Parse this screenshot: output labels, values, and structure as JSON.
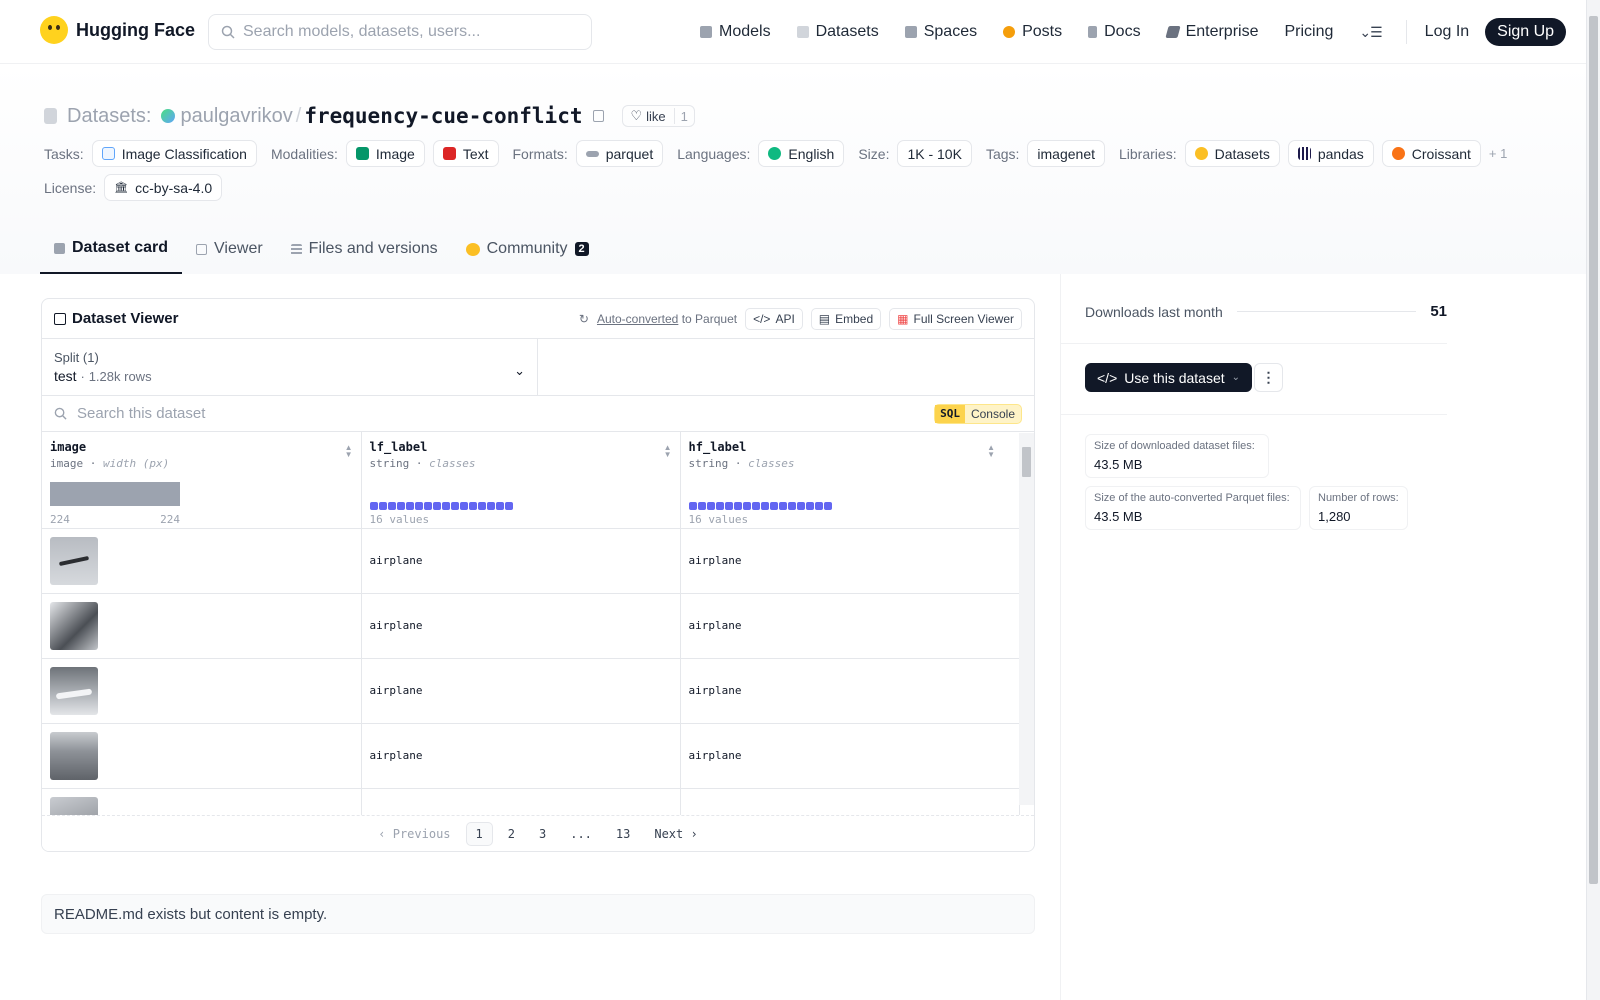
{
  "nav": {
    "brand": "Hugging Face",
    "search_placeholder": "Search models, datasets, users...",
    "links": [
      {
        "label": "Models",
        "icon": "models-icon",
        "color": "#9ca3af"
      },
      {
        "label": "Datasets",
        "icon": "datasets-icon",
        "color": "#d1d5db"
      },
      {
        "label": "Spaces",
        "icon": "spaces-icon",
        "color": "#9ca3af"
      },
      {
        "label": "Posts",
        "icon": "posts-icon",
        "color": "#f59e0b"
      },
      {
        "label": "Docs",
        "icon": "docs-icon",
        "color": "#9ca3af"
      },
      {
        "label": "Enterprise",
        "icon": "enterprise-icon",
        "color": "#6b7280"
      }
    ],
    "pricing": "Pricing",
    "login": "Log In",
    "signup": "Sign Up"
  },
  "header": {
    "section": "Datasets:",
    "user": "paulgavrikov",
    "dataset": "frequency-cue-conflict",
    "like_label": "like",
    "like_count": "1",
    "tasks_label": "Tasks:",
    "task": "Image Classification",
    "modalities_label": "Modalities:",
    "modalities": [
      "Image",
      "Text"
    ],
    "formats_label": "Formats:",
    "format": "parquet",
    "languages_label": "Languages:",
    "language": "English",
    "size_label": "Size:",
    "size": "1K - 10K",
    "tags_label": "Tags:",
    "tag": "imagenet",
    "libraries_label": "Libraries:",
    "libraries": [
      "Datasets",
      "pandas",
      "Croissant"
    ],
    "libraries_more": "+ 1",
    "license_label": "License:",
    "license": "cc-by-sa-4.0"
  },
  "tabs": [
    {
      "label": "Dataset card",
      "active": true
    },
    {
      "label": "Viewer"
    },
    {
      "label": "Files and versions"
    },
    {
      "label": "Community",
      "badge": "2"
    }
  ],
  "viewer": {
    "title": "Dataset Viewer",
    "auto_converted": "Auto-converted",
    "to_parquet": "to Parquet",
    "api": "API",
    "embed": "Embed",
    "fullscreen": "Full Screen Viewer",
    "split_label": "Split (1)",
    "split_name": "test",
    "split_rows": "1.28k rows",
    "search_placeholder": "Search this dataset",
    "sql": "SQL",
    "console": "Console",
    "columns": [
      {
        "name": "image",
        "type": "image",
        "meta": "width (px)",
        "hist_min": "224",
        "hist_max": "224"
      },
      {
        "name": "lf_label",
        "type": "string",
        "meta": "classes",
        "values": "16 values"
      },
      {
        "name": "hf_label",
        "type": "string",
        "meta": "classes",
        "values": "16 values"
      }
    ],
    "rows": [
      {
        "lf": "airplane",
        "hf": "airplane"
      },
      {
        "lf": "airplane",
        "hf": "airplane"
      },
      {
        "lf": "airplane",
        "hf": "airplane"
      },
      {
        "lf": "airplane",
        "hf": "airplane"
      }
    ],
    "pager": {
      "prev": "Previous",
      "pages": [
        "1",
        "2",
        "3",
        "...",
        "13"
      ],
      "next": "Next",
      "current": "1"
    }
  },
  "readme": "README.md exists but content is empty.",
  "sidebar": {
    "downloads_label": "Downloads last month",
    "downloads": "51",
    "use_button": "Use this dataset",
    "size_dl_label": "Size of downloaded dataset files:",
    "size_dl": "43.5 MB",
    "size_pq_label": "Size of the auto-converted Parquet files:",
    "size_pq": "43.5 MB",
    "rows_label": "Number of rows:",
    "rows": "1,280"
  }
}
